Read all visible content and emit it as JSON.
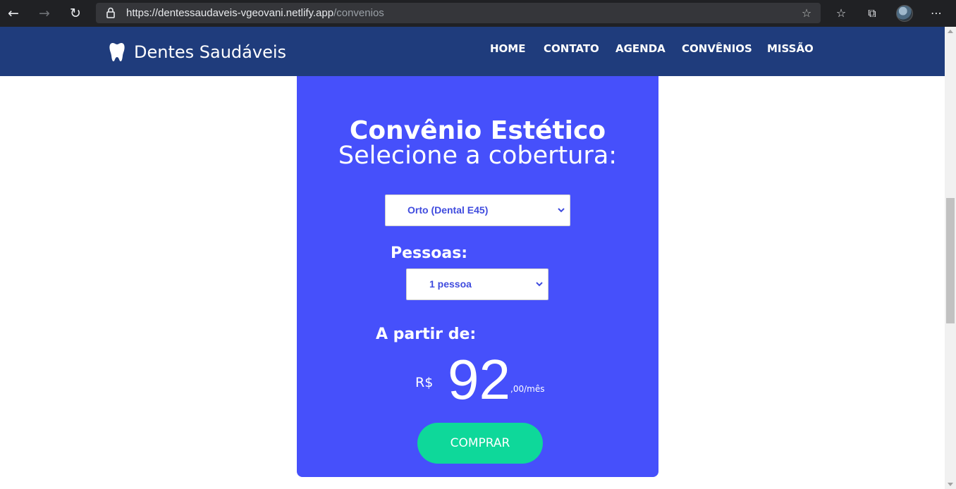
{
  "browser": {
    "url_host": "https://dentessaudaveis-vgeovani.netlify.app",
    "url_path": "/convenios",
    "icons": [
      "back-icon",
      "forward-icon",
      "reload-icon",
      "lock-icon",
      "favorite-add-icon",
      "favorites-icon",
      "collections-icon",
      "profile-avatar",
      "more-icon"
    ]
  },
  "navbar": {
    "brand": "Dentes Saudáveis",
    "menu": [
      "HOME",
      "CONTATO",
      "AGENDA",
      "CONVÊNIOS",
      "MISSÃO"
    ]
  },
  "card": {
    "title": "Convênio Estético",
    "subtitle": "Selecione a cobertura:",
    "coverage_selected": "Orto (Dental E45)",
    "people_label": "Pessoas:",
    "people_selected": "1 pessoa",
    "from_label": "A partir de:",
    "currency": "R$",
    "amount": "92",
    "cents_suffix": ",00/mês",
    "buy_label": "COMPRAR"
  },
  "colors": {
    "navbar": "#1f3c7c",
    "card": "#4650fb",
    "buy_button": "#0ed89a",
    "select_text": "#3f4bde"
  }
}
